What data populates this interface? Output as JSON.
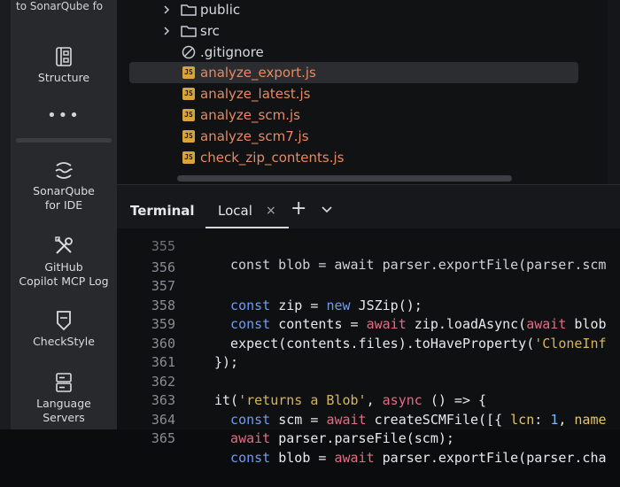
{
  "sidebar": {
    "top_text": "to SonarQube fo",
    "items": [
      {
        "label": "Structure",
        "icon": "structure-icon"
      },
      {
        "label": "SonarQube\nfor IDE",
        "icon": "sonarqube-icon"
      },
      {
        "label": "GitHub\nCopilot MCP Log",
        "icon": "tools-icon"
      },
      {
        "label": "CheckStyle",
        "icon": "checkstyle-icon"
      },
      {
        "label": "Language\nServers",
        "icon": "servers-icon"
      }
    ],
    "more": "•••"
  },
  "tree": {
    "items": [
      {
        "name": "public",
        "type": "folder"
      },
      {
        "name": "src",
        "type": "folder"
      },
      {
        "name": ".gitignore",
        "type": "ignore"
      },
      {
        "name": "analyze_export.js",
        "type": "js",
        "selected": true
      },
      {
        "name": "analyze_latest.js",
        "type": "js"
      },
      {
        "name": "analyze_scm.js",
        "type": "js"
      },
      {
        "name": "analyze_scm7.js",
        "type": "js"
      },
      {
        "name": "check_zip_contents.js",
        "type": "js"
      }
    ],
    "js_badge": "JS"
  },
  "terminal": {
    "title": "Terminal",
    "tab": "Local",
    "close": "×",
    "plus": "+"
  },
  "code": {
    "lines": [
      {
        "n": "356",
        "text": ""
      },
      {
        "n": "357",
        "text": "  const zip = new JSZip();"
      },
      {
        "n": "358",
        "text": "  const contents = await zip.loadAsync(await blob"
      },
      {
        "n": "359",
        "text": "  expect(contents.files).toHaveProperty('CloneInf"
      },
      {
        "n": "360",
        "text": "});"
      },
      {
        "n": "361",
        "text": ""
      },
      {
        "n": "362",
        "text": "it('returns a Blob', async () => {"
      },
      {
        "n": "363",
        "text": "  const scm = await createSCMFile([{ lcn: 1, name"
      },
      {
        "n": "364",
        "text": "  await parser.parseFile(scm);"
      },
      {
        "n": "365",
        "text": "  const blob = await parser.exportFile(parser.cha"
      }
    ]
  },
  "colors": {
    "keyword": "#6f9cf0",
    "await": "#e56b84",
    "string": "#d8b55a",
    "file_js": "#e58a63"
  }
}
